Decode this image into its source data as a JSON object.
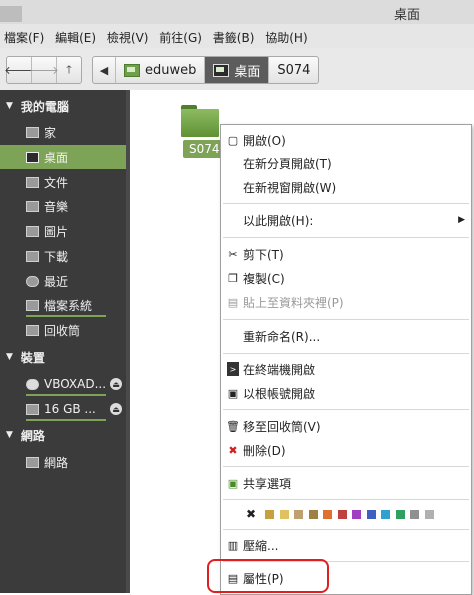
{
  "window": {
    "title": "桌面"
  },
  "menubar": [
    "檔案(F)",
    "編輯(E)",
    "檢視(V)",
    "前往(G)",
    "書籤(B)",
    "協助(H)"
  ],
  "toolbar": {
    "breadcrumbs": [
      {
        "label": "eduweb",
        "icon": "home-folder-icon"
      },
      {
        "label": "桌面",
        "icon": "desktop-icon",
        "active": true
      },
      {
        "label": "S074",
        "icon": ""
      }
    ]
  },
  "sidebar": {
    "sections": [
      {
        "label": "我的電腦",
        "items": [
          {
            "label": "家",
            "icon": "home-icon"
          },
          {
            "label": "桌面",
            "icon": "desktop-icon",
            "selected": true
          },
          {
            "label": "文件",
            "icon": "documents-icon"
          },
          {
            "label": "音樂",
            "icon": "music-icon"
          },
          {
            "label": "圖片",
            "icon": "pictures-icon"
          },
          {
            "label": "下載",
            "icon": "downloads-icon"
          },
          {
            "label": "最近",
            "icon": "recent-icon"
          },
          {
            "label": "檔案系統",
            "icon": "filesystem-icon"
          },
          {
            "label": "回收筒",
            "icon": "trash-icon"
          }
        ]
      },
      {
        "label": "裝置",
        "items": [
          {
            "label": "VBOXAD...",
            "icon": "disc-icon"
          },
          {
            "label": "16 GB ...",
            "icon": "drive-icon"
          }
        ]
      },
      {
        "label": "網路",
        "items": [
          {
            "label": "網路",
            "icon": "network-icon"
          }
        ]
      }
    ]
  },
  "content": {
    "folder_label": "S074"
  },
  "context_menu": {
    "items": [
      "開啟(O)",
      "在新分頁開啟(T)",
      "在新視窗開啟(W)",
      "以此開啟(H):",
      "剪下(T)",
      "複製(C)",
      "貼上至資料夾裡(P)",
      "重新命名(R)...",
      "在終端機開啟",
      "以根帳號開啟",
      "移至回收筒(V)",
      "刪除(D)",
      "共享選項",
      "壓縮...",
      "屬性(P)"
    ],
    "swatch_colors": [
      "#c8a040",
      "#e0c060",
      "#c0a070",
      "#a08040",
      "#e07030",
      "#c04040",
      "#a040c0",
      "#4060c0",
      "#30a0d0",
      "#30a060",
      "#909090",
      "#b0b0b0"
    ]
  },
  "colors": {
    "accent": "#7da356",
    "sidebar_bg": "#3b3b3b",
    "highlight": "#e02020"
  }
}
